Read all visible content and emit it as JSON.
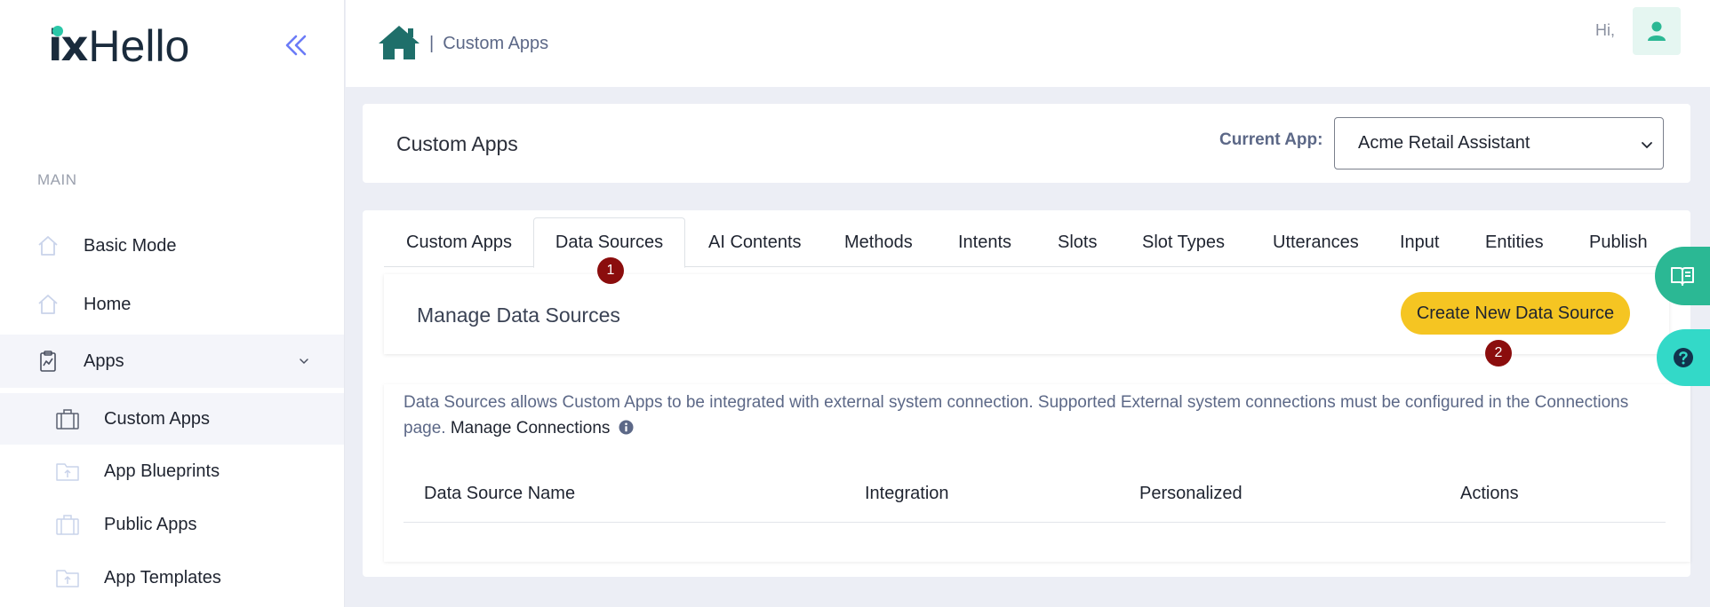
{
  "sidebar": {
    "logo": {
      "prefix": "ix",
      "name": "Hello"
    },
    "section_label": "MAIN",
    "items": [
      {
        "label": "Basic Mode",
        "icon": "home-outline-icon"
      },
      {
        "label": "Home",
        "icon": "home-outline-icon"
      },
      {
        "label": "Apps",
        "icon": "clipboard-chart-icon",
        "expanded": true
      }
    ],
    "sub_items": [
      {
        "label": "Custom Apps",
        "icon": "briefcase-icon",
        "active": true
      },
      {
        "label": "App Blueprints",
        "icon": "folder-upload-icon"
      },
      {
        "label": "Public Apps",
        "icon": "briefcase-icon"
      },
      {
        "label": "App Templates",
        "icon": "folder-upload-icon"
      }
    ]
  },
  "header": {
    "breadcrumb_sep": "|",
    "breadcrumb": "Custom Apps",
    "greeting": "Hi,"
  },
  "title_card": {
    "title": "Custom Apps",
    "current_app_label": "Current App:",
    "current_app_value": "Acme Retail Assistant"
  },
  "tabs": [
    {
      "label": "Custom Apps"
    },
    {
      "label": "Data Sources",
      "active": true
    },
    {
      "label": "AI Contents"
    },
    {
      "label": "Methods"
    },
    {
      "label": "Intents"
    },
    {
      "label": "Slots"
    },
    {
      "label": "Slot Types"
    },
    {
      "label": "Utterances"
    },
    {
      "label": "Input"
    },
    {
      "label": "Entities"
    },
    {
      "label": "Publish"
    }
  ],
  "badges": [
    "1",
    "2"
  ],
  "manage": {
    "title": "Manage Data Sources",
    "create_button": "Create New Data Source"
  },
  "info": {
    "text": "Data Sources allows Custom Apps to be integrated with external system connection. Supported External system connections must be configured in the Connections page.",
    "link": "Manage Connections"
  },
  "table": {
    "columns": [
      "Data Source Name",
      "Integration",
      "Personalized",
      "Actions"
    ]
  },
  "colors": {
    "accent_green": "#2bb894",
    "help_teal": "#33d9c8",
    "create_yellow": "#f5c522",
    "badge_red": "#8b0d0d",
    "home_teal": "#1f6f6a"
  }
}
